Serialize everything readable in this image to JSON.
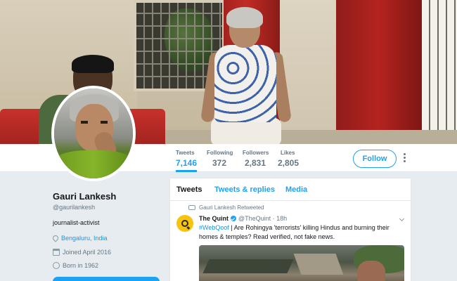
{
  "profile": {
    "name": "Gauri Lankesh",
    "handle": "@gaurilankesh",
    "bio": "journalist-activist",
    "location": "Bengaluru, India",
    "joined": "Joined April 2016",
    "born": "Born in 1962"
  },
  "stats": [
    {
      "label": "Tweets",
      "value": "7,146"
    },
    {
      "label": "Following",
      "value": "372"
    },
    {
      "label": "Followers",
      "value": "2,831"
    },
    {
      "label": "Likes",
      "value": "2,805"
    }
  ],
  "follow_label": "Follow",
  "timeline": {
    "tabs": [
      "Tweets",
      "Tweets & replies",
      "Media"
    ],
    "tweet": {
      "retweet_note": "Gauri Lankesh Retweeted",
      "author": "The Quint",
      "author_handle": "@TheQuint",
      "time": "18h",
      "hashtag": "#WebQoof",
      "text": " | Are Rohingya 'terrorists' killing Hindus and burning their homes & temples? Read verified, not fake news."
    }
  },
  "colors": {
    "accent": "#1da1f2",
    "background": "#e6ecf0"
  },
  "icons": [
    "pin-icon",
    "calendar-icon",
    "balloon-icon",
    "retweet-icon",
    "verified-icon",
    "more-icon",
    "caret-down-icon"
  ]
}
